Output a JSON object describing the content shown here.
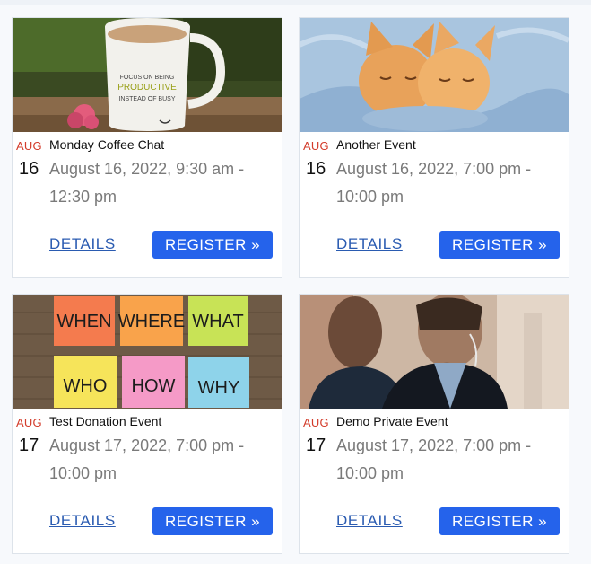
{
  "events": [
    {
      "month": "AUG",
      "day": "16",
      "title": "Monday Coffee Chat",
      "time_line1": "August 16, 2022, 9:30 am -",
      "time_line2": "12:30 pm",
      "details_label": "DETAILS",
      "register_label": "REGISTER »",
      "image": "coffee-mug-photo",
      "image_text": [
        "FOCUS ON BEING",
        "PRODUCTIVE",
        "INSTEAD OF BUSY"
      ]
    },
    {
      "month": "AUG",
      "day": "16",
      "title": "Another Event",
      "time_line1": "August 16, 2022, 7:00 pm -",
      "time_line2": "10:00 pm",
      "details_label": "DETAILS",
      "register_label": "REGISTER »",
      "image": "kittens-photo"
    },
    {
      "month": "AUG",
      "day": "17",
      "title": "Test Donation Event",
      "time_line1": "August 17, 2022, 7:00 pm -",
      "time_line2": "10:00 pm",
      "details_label": "DETAILS",
      "register_label": "REGISTER »",
      "image": "sticky-notes-photo",
      "image_text": [
        "WHEN",
        "WHERE",
        "WHAT",
        "WHO",
        "HOW",
        "WHY"
      ]
    },
    {
      "month": "AUG",
      "day": "17",
      "title": "Demo Private Event",
      "time_line1": "August 17, 2022, 7:00 pm -",
      "time_line2": "10:00 pm",
      "details_label": "DETAILS",
      "register_label": "REGISTER »",
      "image": "security-guards-photo"
    }
  ],
  "colors": {
    "month": "#d33c2b",
    "link": "#2a5bb1",
    "button": "#2563eb",
    "time_text": "#7a7a7a"
  }
}
